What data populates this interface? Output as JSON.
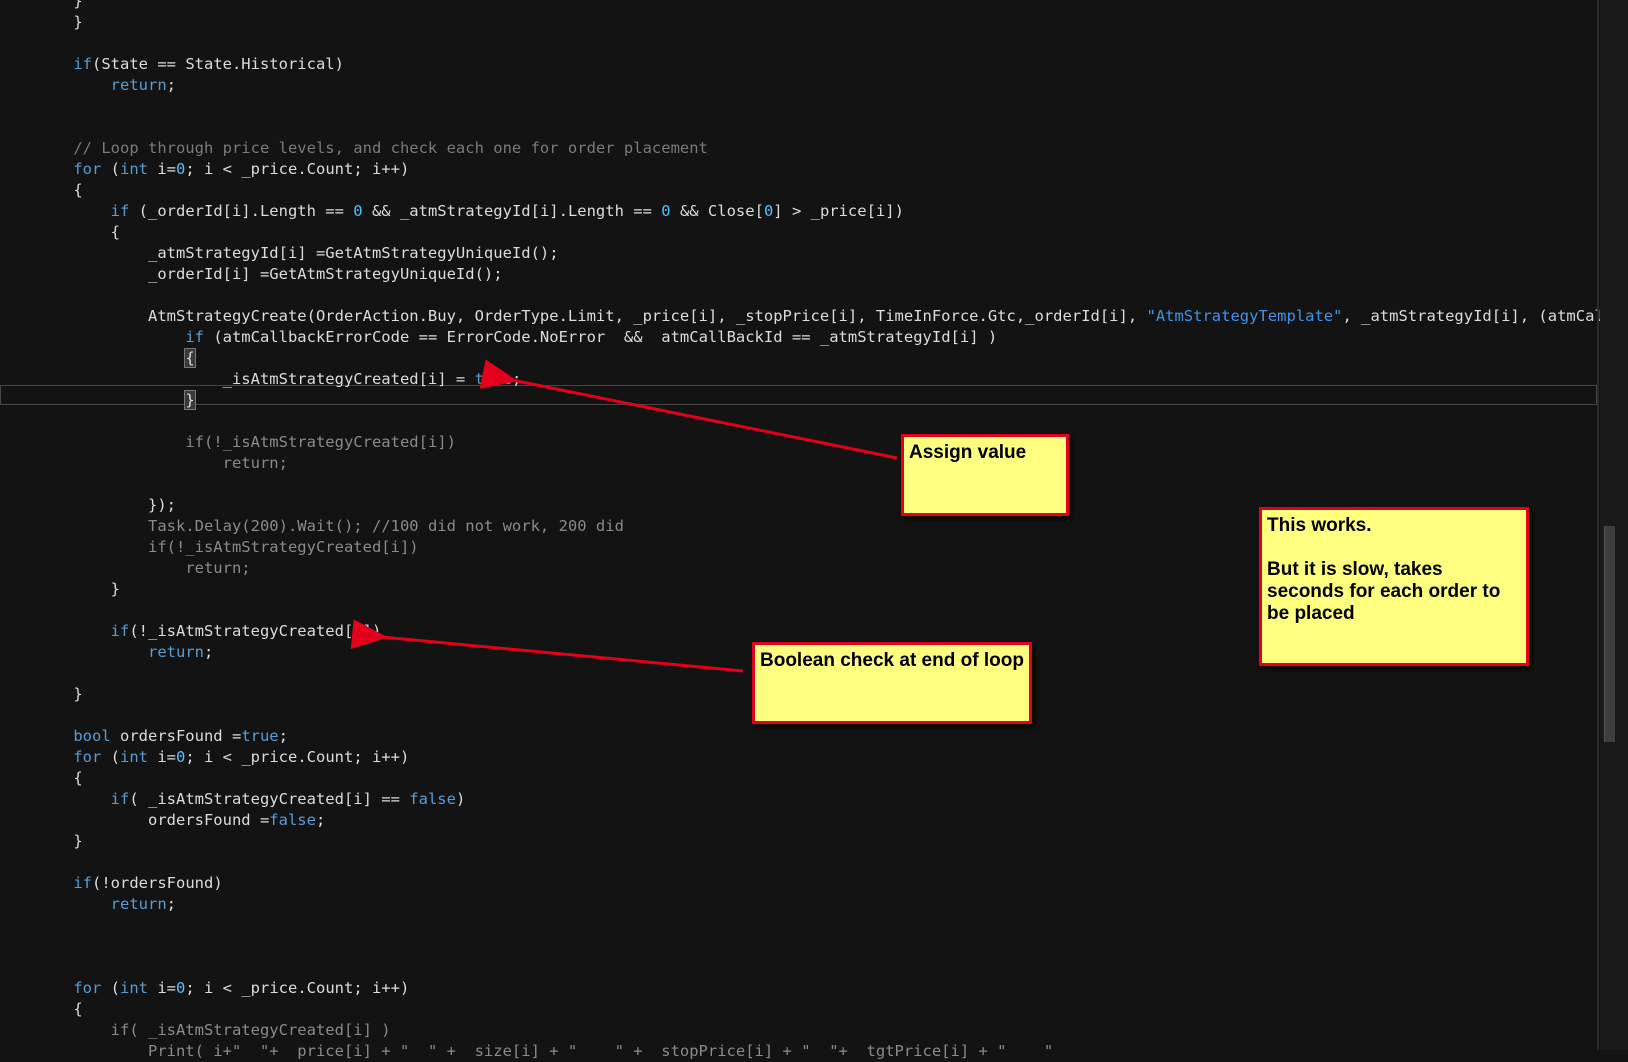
{
  "code_lines": [
    {
      "parts": [
        {
          "t": "    }"
        }
      ]
    },
    {
      "parts": [
        {
          "t": "    }"
        }
      ]
    },
    {
      "parts": [
        {
          "t": ""
        }
      ]
    },
    {
      "parts": [
        {
          "t": "    "
        },
        {
          "t": "if",
          "c": "kw"
        },
        {
          "t": "(State == State.Historical)"
        }
      ]
    },
    {
      "parts": [
        {
          "t": "        "
        },
        {
          "t": "return",
          "c": "kw"
        },
        {
          "t": ";"
        }
      ]
    },
    {
      "parts": [
        {
          "t": ""
        }
      ]
    },
    {
      "parts": [
        {
          "t": ""
        }
      ]
    },
    {
      "parts": [
        {
          "t": "    "
        },
        {
          "t": "// Loop through price levels, and check each one for order placement",
          "c": "cm"
        }
      ]
    },
    {
      "parts": [
        {
          "t": "    "
        },
        {
          "t": "for",
          "c": "kw"
        },
        {
          "t": " ("
        },
        {
          "t": "int",
          "c": "kw"
        },
        {
          "t": " i="
        },
        {
          "t": "0",
          "c": "num"
        },
        {
          "t": "; i < _price.Count; i++)"
        }
      ]
    },
    {
      "parts": [
        {
          "t": "    {"
        }
      ]
    },
    {
      "parts": [
        {
          "t": "        "
        },
        {
          "t": "if",
          "c": "kw"
        },
        {
          "t": " (_orderId[i].Length == "
        },
        {
          "t": "0",
          "c": "num"
        },
        {
          "t": " && _atmStrategyId[i].Length == "
        },
        {
          "t": "0",
          "c": "num"
        },
        {
          "t": " && Close["
        },
        {
          "t": "0",
          "c": "num"
        },
        {
          "t": "] > _price[i])"
        }
      ]
    },
    {
      "parts": [
        {
          "t": "        {"
        }
      ]
    },
    {
      "parts": [
        {
          "t": "            _atmStrategyId[i] =GetAtmStrategyUniqueId();"
        }
      ]
    },
    {
      "parts": [
        {
          "t": "            _orderId[i] =GetAtmStrategyUniqueId();"
        }
      ]
    },
    {
      "parts": [
        {
          "t": ""
        }
      ]
    },
    {
      "parts": [
        {
          "t": "            AtmStrategyCreate(OrderAction.Buy, OrderType.Limit, _price[i], _stopPrice[i], TimeInForce.Gtc,_orderId[i], "
        },
        {
          "t": "\"AtmStrategyTemplate\"",
          "c": "str"
        },
        {
          "t": ", _atmStrategyId[i], (atmCallbackE"
        }
      ]
    },
    {
      "parts": [
        {
          "t": "                "
        },
        {
          "t": "if",
          "c": "kw"
        },
        {
          "t": " (atmCallbackErrorCode == ErrorCode.NoError  &&  atmCallBackId == _atmStrategyId[i] )"
        }
      ]
    },
    {
      "parts": [
        {
          "t": "                "
        },
        {
          "t": "{",
          "c": "hl"
        }
      ]
    },
    {
      "parts": [
        {
          "t": "                    _isAtmStrategyCreated[i] = "
        },
        {
          "t": "true",
          "c": "kw"
        },
        {
          "t": ";"
        }
      ]
    },
    {
      "parts": [
        {
          "t": "                "
        },
        {
          "t": "}",
          "c": "hl"
        }
      ]
    },
    {
      "parts": [
        {
          "t": ""
        }
      ]
    },
    {
      "parts": [
        {
          "t": "                "
        },
        {
          "t": "if(!_isAtmStrategyCreated[i])",
          "c": "dim"
        }
      ]
    },
    {
      "parts": [
        {
          "t": "                    "
        },
        {
          "t": "return;",
          "c": "dim"
        }
      ]
    },
    {
      "parts": [
        {
          "t": ""
        }
      ]
    },
    {
      "parts": [
        {
          "t": "            });"
        }
      ]
    },
    {
      "parts": [
        {
          "t": "            "
        },
        {
          "t": "Task.Delay(200).Wait(); //100 did not work, 200 did",
          "c": "dim"
        }
      ]
    },
    {
      "parts": [
        {
          "t": "            "
        },
        {
          "t": "if(!_isAtmStrategyCreated[i])",
          "c": "dim"
        }
      ]
    },
    {
      "parts": [
        {
          "t": "                "
        },
        {
          "t": "return;",
          "c": "dim"
        }
      ]
    },
    {
      "parts": [
        {
          "t": "        }"
        }
      ]
    },
    {
      "parts": [
        {
          "t": ""
        }
      ]
    },
    {
      "parts": [
        {
          "t": "        "
        },
        {
          "t": "if",
          "c": "kw"
        },
        {
          "t": "(!_isAtmStrategyCreated[i])"
        }
      ]
    },
    {
      "parts": [
        {
          "t": "            "
        },
        {
          "t": "return",
          "c": "kw"
        },
        {
          "t": ";"
        }
      ]
    },
    {
      "parts": [
        {
          "t": ""
        }
      ]
    },
    {
      "parts": [
        {
          "t": "    }"
        }
      ]
    },
    {
      "parts": [
        {
          "t": ""
        }
      ]
    },
    {
      "parts": [
        {
          "t": "    "
        },
        {
          "t": "bool",
          "c": "kw"
        },
        {
          "t": " ordersFound ="
        },
        {
          "t": "true",
          "c": "kw"
        },
        {
          "t": ";"
        }
      ]
    },
    {
      "parts": [
        {
          "t": "    "
        },
        {
          "t": "for",
          "c": "kw"
        },
        {
          "t": " ("
        },
        {
          "t": "int",
          "c": "kw"
        },
        {
          "t": " i="
        },
        {
          "t": "0",
          "c": "num"
        },
        {
          "t": "; i < _price.Count; i++)"
        }
      ]
    },
    {
      "parts": [
        {
          "t": "    {"
        }
      ]
    },
    {
      "parts": [
        {
          "t": "        "
        },
        {
          "t": "if",
          "c": "kw"
        },
        {
          "t": "( _isAtmStrategyCreated[i] == "
        },
        {
          "t": "false",
          "c": "kw"
        },
        {
          "t": ")"
        }
      ]
    },
    {
      "parts": [
        {
          "t": "            ordersFound ="
        },
        {
          "t": "false",
          "c": "kw"
        },
        {
          "t": ";"
        }
      ]
    },
    {
      "parts": [
        {
          "t": "    }"
        }
      ]
    },
    {
      "parts": [
        {
          "t": ""
        }
      ]
    },
    {
      "parts": [
        {
          "t": "    "
        },
        {
          "t": "if",
          "c": "kw"
        },
        {
          "t": "(!ordersFound)"
        }
      ]
    },
    {
      "parts": [
        {
          "t": "        "
        },
        {
          "t": "return",
          "c": "kw"
        },
        {
          "t": ";"
        }
      ]
    },
    {
      "parts": [
        {
          "t": ""
        }
      ]
    },
    {
      "parts": [
        {
          "t": ""
        }
      ]
    },
    {
      "parts": [
        {
          "t": ""
        }
      ]
    },
    {
      "parts": [
        {
          "t": "    "
        },
        {
          "t": "for",
          "c": "kw"
        },
        {
          "t": " ("
        },
        {
          "t": "int",
          "c": "kw"
        },
        {
          "t": " i="
        },
        {
          "t": "0",
          "c": "num"
        },
        {
          "t": "; i < _price.Count; i++)"
        }
      ]
    },
    {
      "parts": [
        {
          "t": "    {"
        }
      ]
    },
    {
      "parts": [
        {
          "t": "        "
        },
        {
          "t": "if( _isAtmStrategyCreated[i] )",
          "c": "dim"
        }
      ]
    },
    {
      "parts": [
        {
          "t": "            "
        },
        {
          "t": "Print( i+\"  \"+  price[i] + \"  \" +  size[i] + \"    \" +  stopPrice[i] + \"  \"+  tgtPrice[i] + \"    \"",
          "c": "dim"
        }
      ]
    }
  ],
  "notes": {
    "assign": "Assign value",
    "boolean_check": "Boolean check at end of loop",
    "works": "This works.\n\nBut it is slow, takes seconds for each order to be placed"
  }
}
